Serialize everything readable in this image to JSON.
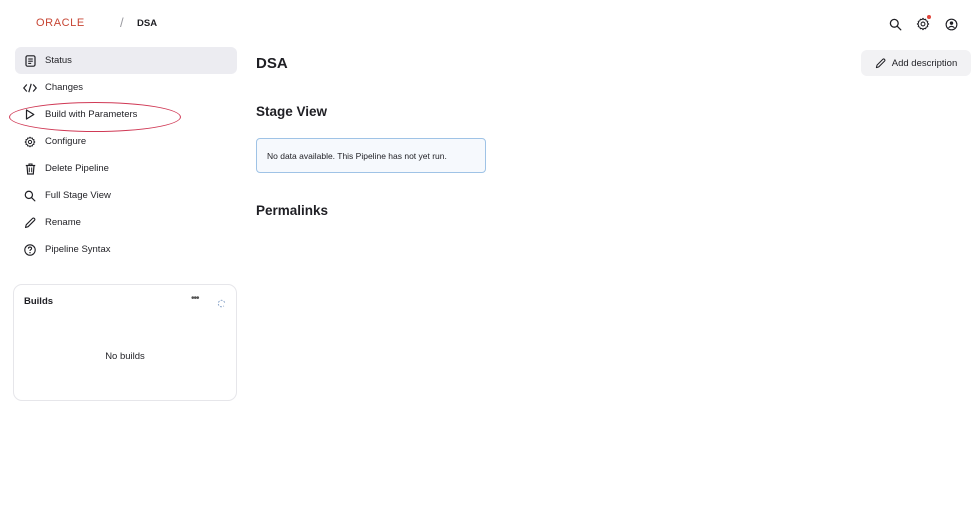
{
  "header": {
    "logo": "ORACLE",
    "separator": "/",
    "breadcrumb": "DSA"
  },
  "sidebar": {
    "items": [
      {
        "label": "Status",
        "icon": "document-icon",
        "active": true
      },
      {
        "label": "Changes",
        "icon": "code-icon"
      },
      {
        "label": "Build with Parameters",
        "icon": "play-icon",
        "highlighted": true
      },
      {
        "label": "Configure",
        "icon": "gear-icon"
      },
      {
        "label": "Delete Pipeline",
        "icon": "trash-icon"
      },
      {
        "label": "Full Stage View",
        "icon": "search-icon"
      },
      {
        "label": "Rename",
        "icon": "pencil-icon"
      },
      {
        "label": "Pipeline Syntax",
        "icon": "help-icon"
      }
    ]
  },
  "builds": {
    "title": "Builds",
    "more": "•••",
    "empty_text": "No builds"
  },
  "main": {
    "title": "DSA",
    "add_description": "Add description",
    "stage_view_title": "Stage View",
    "stage_view_notice": "No data available. This Pipeline has not yet run.",
    "permalinks_title": "Permalinks"
  },
  "colors": {
    "brand": "#c74634",
    "active_bg": "#ececf1",
    "highlight_oval": "#d03a56",
    "notice_border": "#9fc3e6",
    "notification_dot": "#e0443a"
  }
}
